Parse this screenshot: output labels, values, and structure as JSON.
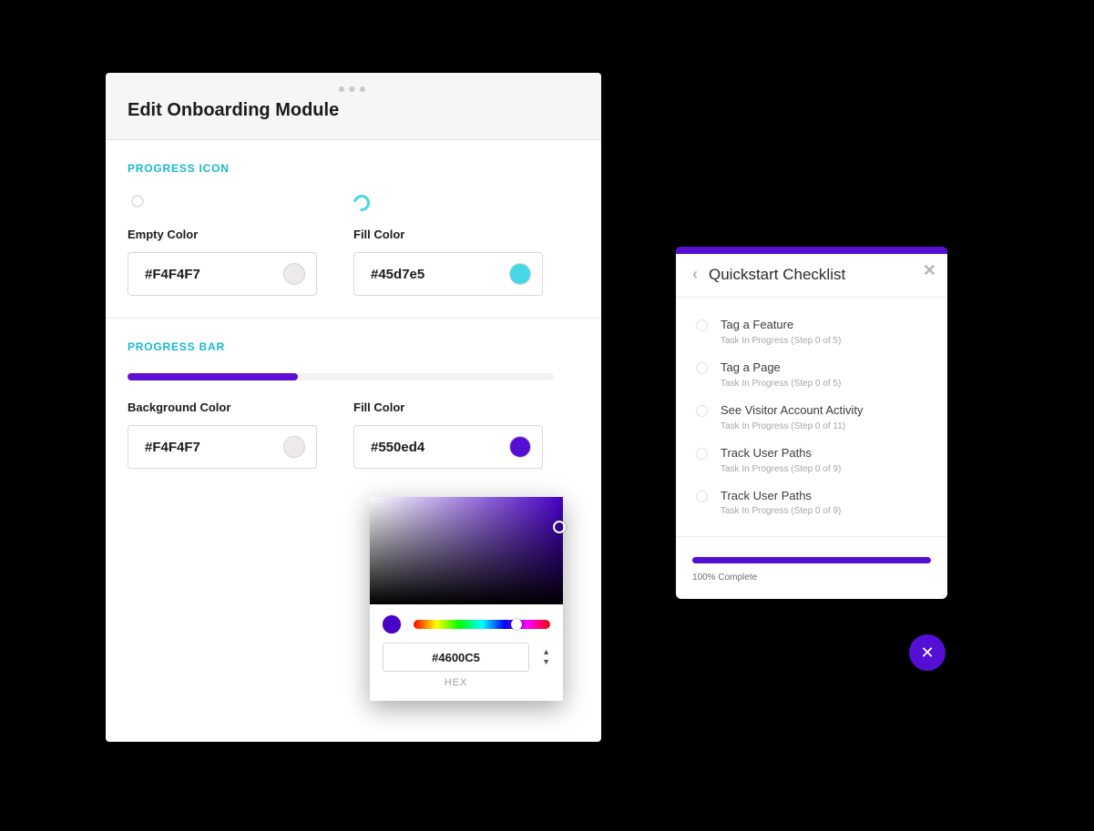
{
  "editor": {
    "title": "Edit Onboarding Module",
    "progress_icon": {
      "section_label": "PROGRESS ICON",
      "empty_label": "Empty Color",
      "empty_value": "#F4F4F7",
      "empty_swatch": "#eceaea",
      "fill_label": "Fill Color",
      "fill_value": "#45d7e5",
      "fill_swatch": "#45d7e5"
    },
    "progress_bar": {
      "section_label": "PROGRESS BAR",
      "fill_percent": 40,
      "bg_label": "Background Color",
      "bg_value": "#F4F4F7",
      "bg_swatch": "#eceaea",
      "fill_label": "Fill Color",
      "fill_value": "#550ed4",
      "fill_swatch": "#550ed4"
    }
  },
  "picker": {
    "hex_value": "#4600C5",
    "format_label": "HEX"
  },
  "checklist": {
    "title": "Quickstart Checklist",
    "items": [
      {
        "title": "Tag a Feature",
        "sub": "Task In Progress (Step 0 of 5)"
      },
      {
        "title": "Tag a Page",
        "sub": "Task In Progress (Step 0 of 5)"
      },
      {
        "title": "See Visitor Account Activity",
        "sub": "Task In Progress (Step 0 of 11)"
      },
      {
        "title": "Track User Paths",
        "sub": "Task In Progress (Step 0 of 9)"
      },
      {
        "title": "Track User Paths",
        "sub": "Task In Progress (Step 0 of 9)"
      }
    ],
    "complete_label": "100% Complete"
  }
}
